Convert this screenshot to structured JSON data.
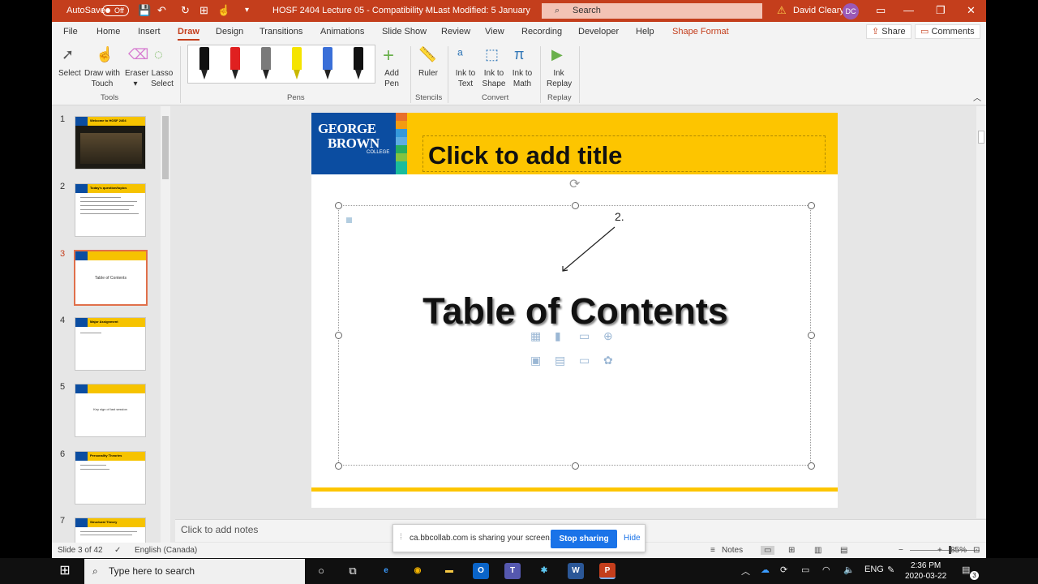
{
  "titlebar": {
    "autosave_label": "AutoSave",
    "autosave_state": "Off",
    "doc_title": "HOSF 2404 Lecture 05 - Compatibility M...",
    "last_modified": "Last Modified: 5 January",
    "search_placeholder": "Search",
    "user_name": "David Cleary",
    "user_initials": "DC"
  },
  "tabs": [
    "File",
    "Home",
    "Insert",
    "Draw",
    "Design",
    "Transitions",
    "Animations",
    "Slide Show",
    "Review",
    "View",
    "Recording",
    "Developer",
    "Help",
    "Shape Format"
  ],
  "active_tab": "Draw",
  "share_label": "Share",
  "comments_label": "Comments",
  "ribbon": {
    "tools": {
      "select": "Select",
      "draw_touch_1": "Draw with",
      "draw_touch_2": "Touch",
      "eraser": "Eraser",
      "lasso_1": "Lasso",
      "lasso_2": "Select",
      "group": "Tools"
    },
    "pens_group": "Pens",
    "pen_colors": [
      "#111111",
      "#e02020",
      "#7a7a7a",
      "#f5e400",
      "#3a6fd8",
      "#111111"
    ],
    "add_pen_1": "Add",
    "add_pen_2": "Pen",
    "ruler": "Ruler",
    "stencils_group": "Stencils",
    "ink_to_text_1": "Ink to",
    "ink_to_text_2": "Text",
    "ink_to_shape_1": "Ink to",
    "ink_to_shape_2": "Shape",
    "ink_to_math_1": "Ink to",
    "ink_to_math_2": "Math",
    "convert_group": "Convert",
    "ink_replay_1": "Ink",
    "ink_replay_2": "Replay",
    "replay_group": "Replay"
  },
  "thumbnails": {
    "numbers": [
      "1",
      "2",
      "3",
      "4",
      "5",
      "6",
      "7"
    ],
    "slide1_title": "Welcome to HOSF 2404",
    "slide2_title": "Today's question/topics",
    "slide3_text": "Table of Contents",
    "slide4_title": "Major Assignment",
    "slide5_text": "Key sign of last session",
    "slide6_title": "Personality Theories",
    "slide7_title": "Structural Theory"
  },
  "slide": {
    "logo_line1": "GEORGE",
    "logo_line2": "BROWN",
    "logo_line3": "COLLEGE",
    "title_placeholder": "Click to add title",
    "annotation_number": "2.",
    "content_text": "Table of Contents"
  },
  "notes_placeholder": "Click to add notes",
  "sharing_banner": {
    "message": "ca.bbcollab.com is sharing your screen.",
    "stop_label": "Stop sharing",
    "hide_label": "Hide"
  },
  "statusbar": {
    "slide_counter": "Slide 3 of 42",
    "language": "English (Canada)",
    "notes_label": "Notes",
    "zoom": "85%"
  },
  "taskbar": {
    "search_placeholder": "Type here to search",
    "time": "2:36 PM",
    "date": "2020-03-22",
    "notification_count": "3"
  }
}
